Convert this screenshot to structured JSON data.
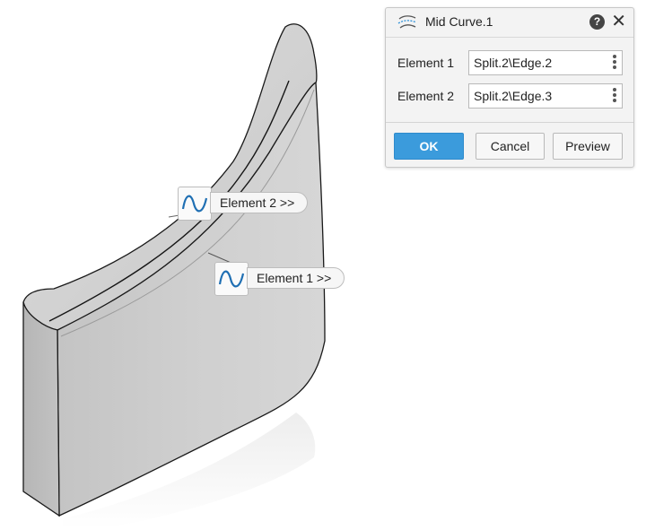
{
  "dialog": {
    "title": "Mid Curve.1",
    "fields": [
      {
        "label": "Element 1",
        "value": "Split.2\\Edge.2"
      },
      {
        "label": "Element 2",
        "value": "Split.2\\Edge.3"
      }
    ],
    "buttons": {
      "ok": "OK",
      "cancel": "Cancel",
      "preview": "Preview"
    },
    "icons": {
      "title": "mid-curve-icon",
      "help": "help-icon",
      "close": "close-icon",
      "field_menu": "kebab-menu-icon"
    }
  },
  "viewport": {
    "tags": [
      {
        "label": "Element 2 >>",
        "icon": "curve-icon"
      },
      {
        "label": "Element 1 >>",
        "icon": "curve-icon"
      }
    ]
  },
  "colors": {
    "accent": "#3b9bdc",
    "curve_icon": "#1f6fb3",
    "solid": "#c9c9c9"
  }
}
